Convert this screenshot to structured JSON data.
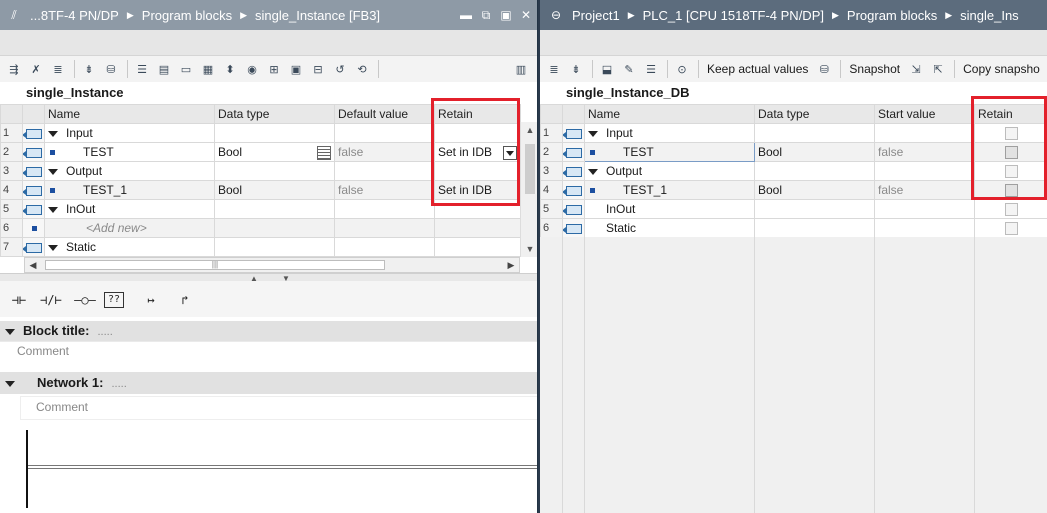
{
  "left": {
    "title": {
      "crumbs": [
        "...8TF-4 PN/DP",
        "Program blocks",
        "single_Instance [FB3]"
      ],
      "pin_icon": "pin-icon"
    },
    "block_name": "single_Instance",
    "columns": [
      "Name",
      "Data type",
      "Default value",
      "Retain"
    ],
    "rows": [
      {
        "num": "1",
        "name": "Input",
        "type": "",
        "default": "",
        "retain": "",
        "section": true
      },
      {
        "num": "2",
        "name": "TEST",
        "type": "Bool",
        "default": "false",
        "retain": "Set in IDB",
        "section": false
      },
      {
        "num": "3",
        "name": "Output",
        "type": "",
        "default": "",
        "retain": "",
        "section": true
      },
      {
        "num": "4",
        "name": "TEST_1",
        "type": "Bool",
        "default": "false",
        "retain": "Set in IDB",
        "section": false
      },
      {
        "num": "5",
        "name": "InOut",
        "type": "",
        "default": "",
        "retain": "",
        "section": true
      },
      {
        "num": "6",
        "name": "<Add new>",
        "type": "",
        "default": "",
        "retain": "",
        "section": false
      },
      {
        "num": "7",
        "name": "Static",
        "type": "",
        "default": "",
        "retain": "",
        "section": true
      }
    ],
    "ladder_symbols": [
      "⊣⊢",
      "⊣/⊢",
      "–○–",
      "??",
      "↦",
      "↱"
    ],
    "block_title_label": "Block title:",
    "block_title_dots": ".....",
    "block_comment": "Comment",
    "network_label": "Network 1:",
    "network_dots": ".....",
    "network_comment": "Comment"
  },
  "right": {
    "title": {
      "crumbs": [
        "Project1",
        "PLC_1 [CPU 1518TF-4 PN/DP]",
        "Program blocks",
        "single_Ins"
      ]
    },
    "toolbar": {
      "keep_actual_values": "Keep actual values",
      "snapshot": "Snapshot",
      "copy_snapshots": "Copy snapsho"
    },
    "block_name": "single_Instance_DB",
    "columns": [
      "Name",
      "Data type",
      "Start value",
      "Retain"
    ],
    "rows": [
      {
        "num": "1",
        "name": "Input",
        "type": "",
        "start": "",
        "section": true
      },
      {
        "num": "2",
        "name": "TEST",
        "type": "Bool",
        "start": "false",
        "section": false
      },
      {
        "num": "3",
        "name": "Output",
        "type": "",
        "start": "",
        "section": true
      },
      {
        "num": "4",
        "name": "TEST_1",
        "type": "Bool",
        "start": "false",
        "section": false
      },
      {
        "num": "5",
        "name": "InOut",
        "type": "",
        "start": "",
        "section": true
      },
      {
        "num": "6",
        "name": "Static",
        "type": "",
        "start": "",
        "section": true
      }
    ]
  },
  "colors": {
    "highlight": "#e3202b",
    "titlebar_active": "#5c6c7d",
    "titlebar_inactive": "#8e9aa6"
  }
}
